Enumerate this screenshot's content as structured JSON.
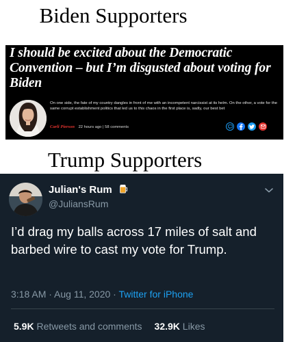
{
  "headings": {
    "biden": "Biden Supporters",
    "trump": "Trump Supporters"
  },
  "article": {
    "headline": "I should be excited about the Democratic Convention – but I’m disgusted about voting for Biden",
    "body": "On one side, the fate of my country dangles in front of me with an incompetent narcissist at its helm. On the other, a vote for the same corrupt establishment politics that led us to this chaos in the first place is, sadly, our best bet",
    "author": "Carli Pierson",
    "time": "22 hours ago",
    "separator": "|",
    "comments": "58 comments",
    "share_icons": [
      "comment-icon",
      "facebook-icon",
      "twitter-icon",
      "email-icon"
    ],
    "colors": {
      "background": "#000000",
      "author": "#e3342f",
      "facebook": "#1877f2",
      "twitter": "#1d9bf0"
    }
  },
  "tweet": {
    "display_name": "Julian's Rum",
    "handle": "@JuliansRum",
    "text": "I’d drag my balls across 17 miles of salt and barbed wire to cast my vote for Trump.",
    "time": "3:18 AM · Aug 11, 2020 · ",
    "source": "Twitter for iPhone",
    "retweets_count": "5.9K",
    "retweets_label": "Retweets and comments",
    "likes_count": "32.9K",
    "likes_label": "Likes",
    "colors": {
      "background": "#15202b",
      "secondary_text": "#8899a6",
      "link": "#1da1f2"
    }
  }
}
